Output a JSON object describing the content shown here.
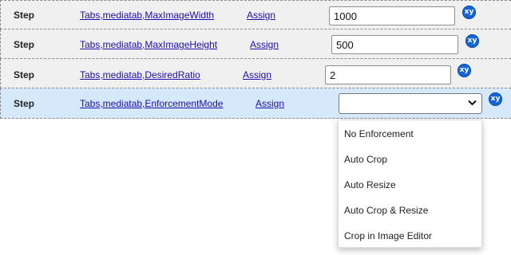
{
  "rows": [
    {
      "step": "Step",
      "path": "Tabs,mediatab,MaxImageWidth",
      "assign": "Assign",
      "value": "1000"
    },
    {
      "step": "Step",
      "path": "Tabs,mediatab,MaxImageHeight",
      "assign": "Assign",
      "value": "500"
    },
    {
      "step": "Step",
      "path": "Tabs,mediatab,DesiredRatio",
      "assign": "Assign",
      "value": "2"
    },
    {
      "step": "Step",
      "path": "Tabs,mediatab,EnforcementMode",
      "assign": "Assign",
      "value": ""
    }
  ],
  "xy_label": "xy",
  "dropdown": {
    "options": [
      "No Enforcement",
      "Auto Crop",
      "Auto Resize",
      "Auto Crop & Resize",
      "Crop in Image Editor"
    ]
  },
  "colors": {
    "link": "#1a0dab",
    "xy_badge": "#1565d8",
    "active_row": "#d6e9fb",
    "row": "#f0f0f0"
  }
}
